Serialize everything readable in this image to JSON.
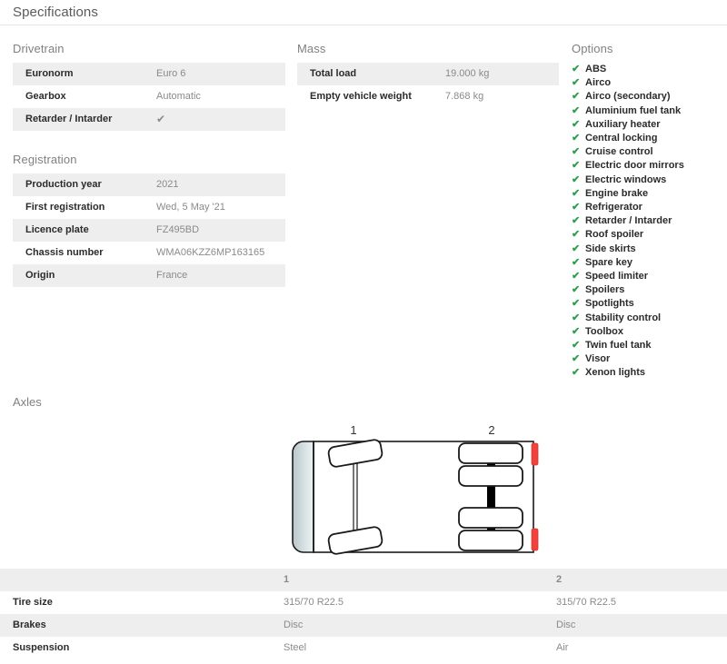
{
  "header": {
    "title": "Specifications"
  },
  "drivetrain": {
    "title": "Drivetrain",
    "rows": [
      {
        "label": "Euronorm",
        "value": "Euro 6"
      },
      {
        "label": "Gearbox",
        "value": "Automatic"
      },
      {
        "label": "Retarder / Intarder",
        "value": "✔"
      }
    ]
  },
  "registration": {
    "title": "Registration",
    "rows": [
      {
        "label": "Production year",
        "value": "2021"
      },
      {
        "label": "First registration",
        "value": "Wed, 5 May '21"
      },
      {
        "label": "Licence plate",
        "value": "FZ495BD"
      },
      {
        "label": "Chassis number",
        "value": "WMA06KZZ6MP163165"
      },
      {
        "label": "Origin",
        "value": "France"
      }
    ]
  },
  "mass": {
    "title": "Mass",
    "rows": [
      {
        "label": "Total load",
        "value": "19.000 kg"
      },
      {
        "label": "Empty vehicle weight",
        "value": "7.868 kg"
      }
    ]
  },
  "options": {
    "title": "Options",
    "check_glyph": "✔",
    "items": [
      "ABS",
      "Airco",
      "Airco (secondary)",
      "Aluminium fuel tank",
      "Auxiliary heater",
      "Central locking",
      "Cruise control",
      "Electric door mirrors",
      "Electric windows",
      "Engine brake",
      "Refrigerator",
      "Retarder / Intarder",
      "Roof spoiler",
      "Side skirts",
      "Spare key",
      "Speed limiter",
      "Spoilers",
      "Spotlights",
      "Stability control",
      "Toolbox",
      "Twin fuel tank",
      "Visor",
      "Xenon lights"
    ]
  },
  "axles": {
    "title": "Axles",
    "diagram": {
      "axle_labels": [
        "1",
        "2"
      ],
      "colors": {
        "cab": "#cdd8da",
        "outline": "#1a1a1a",
        "taillight": "#f0413c",
        "axle_shaft": "#000000"
      }
    },
    "table": {
      "columns": [
        "",
        "1",
        "2"
      ],
      "rows": [
        {
          "label": "Tire size",
          "values": [
            "315/70 R22.5",
            "315/70 R22.5"
          ]
        },
        {
          "label": "Brakes",
          "values": [
            "Disc",
            "Disc"
          ]
        },
        {
          "label": "Suspension",
          "values": [
            "Steel",
            "Air"
          ]
        }
      ]
    }
  }
}
